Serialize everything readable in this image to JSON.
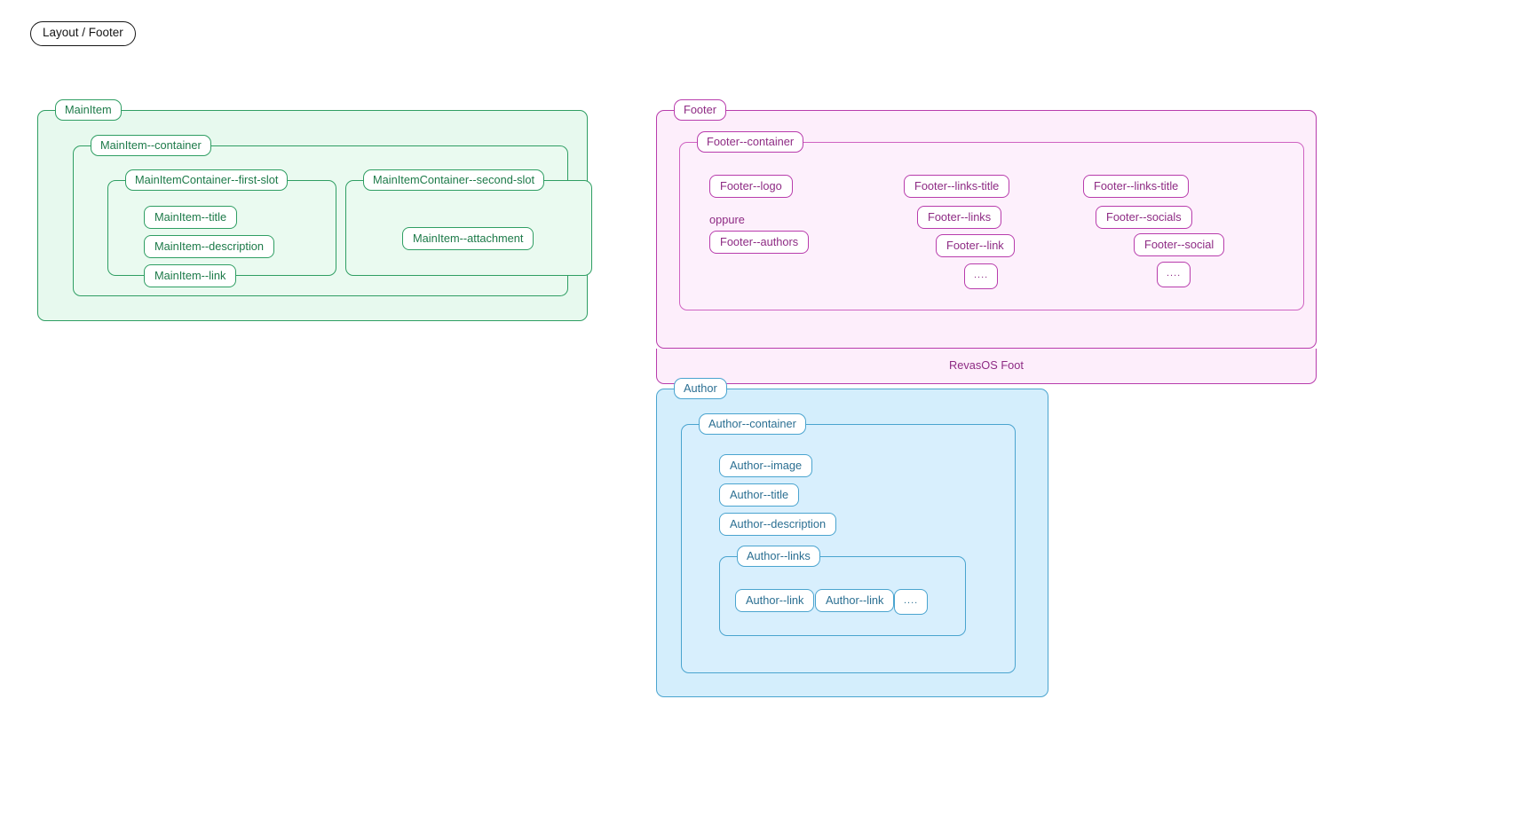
{
  "page": {
    "breadcrumb": "Layout / Footer",
    "background_color": "#ffffff"
  },
  "palette": {
    "green_border": "#2f9e63",
    "green_text": "#1d7a49",
    "green_fill": "#e7f9ee",
    "pink_border": "#b83cac",
    "pink_text": "#8e2b84",
    "pink_fill": "#fdeefb",
    "blue_border": "#4aa4cf",
    "blue_text": "#2b6f92",
    "blue_fill": "#d4eefc",
    "crumb_border": "#161616"
  },
  "main_item": {
    "legend": "MainItem",
    "container": {
      "legend": "MainItem--container",
      "first_slot": {
        "legend": "MainItemContainer--first-slot",
        "nodes": [
          "MainItem--title",
          "MainItem--description",
          "MainItem--link"
        ]
      },
      "second_slot": {
        "legend": "MainItemContainer--second-slot",
        "nodes": [
          "MainItem--attachment"
        ]
      }
    }
  },
  "footer": {
    "legend": "Footer",
    "container": {
      "legend": "Footer--container",
      "column_one": {
        "logo": "Footer--logo",
        "alternative_text": "oppure",
        "authors": "Footer--authors"
      },
      "column_two": {
        "links_title": "Footer--links-title",
        "links": "Footer--links",
        "link": "Footer--link",
        "more": "...."
      },
      "column_three": {
        "links_title": "Footer--links-title",
        "socials": "Footer--socials",
        "social": "Footer--social",
        "more": "...."
      }
    },
    "bottom_bar": "RevasOS Foot"
  },
  "author": {
    "legend": "Author",
    "container": {
      "legend": "Author--container",
      "image": "Author--image",
      "title": "Author--title",
      "description": "Author--description",
      "links": {
        "legend": "Author--links",
        "nodes": [
          "Author--link",
          "Author--link",
          "...."
        ]
      }
    }
  }
}
